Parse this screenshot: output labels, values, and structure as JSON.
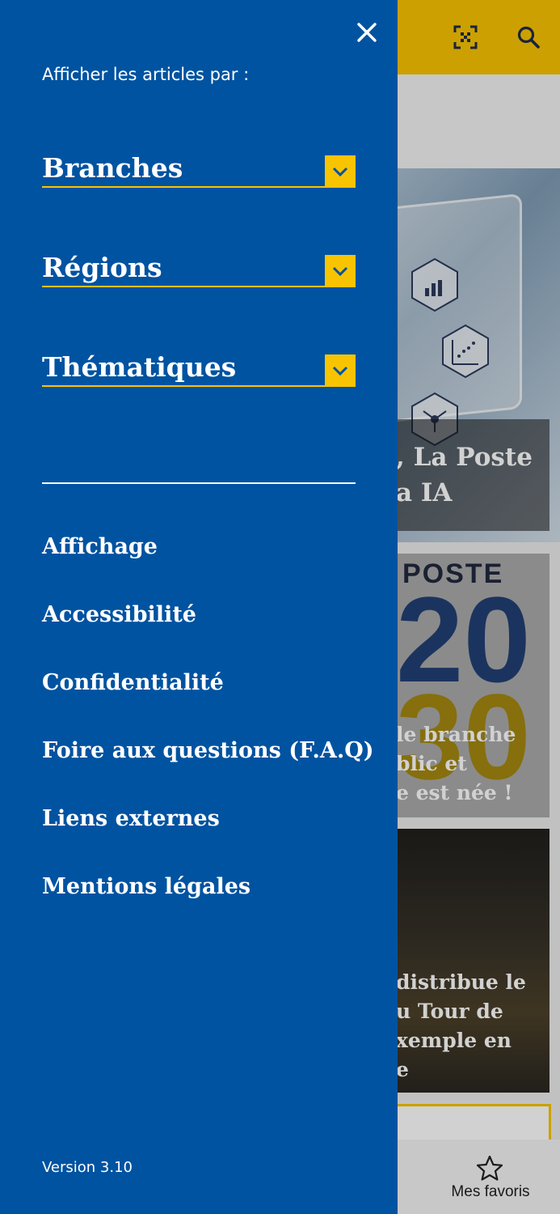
{
  "background": {
    "hero_title_lines": [
      ", La Poste",
      "a IA"
    ],
    "card2_brand": "POSTE",
    "card2_big_top": "20",
    "card2_big_bottom": "30",
    "card2_title_lines": [
      "le branche",
      "blic et",
      "e est née !"
    ],
    "card3_title_lines": [
      " distribue le",
      "u Tour de",
      "xemple en",
      "e"
    ],
    "bottom_nav": {
      "favorites_label": "Mes favoris"
    }
  },
  "drawer": {
    "heading": "Afficher les articles par :",
    "filters": [
      {
        "label": "Branches"
      },
      {
        "label": "Régions"
      },
      {
        "label": "Thématiques"
      }
    ],
    "menu": [
      {
        "label": "Affichage"
      },
      {
        "label": "Accessibilité"
      },
      {
        "label": "Confidentialité"
      },
      {
        "label": "Foire aux questions (F.A.Q)"
      },
      {
        "label": "Liens externes"
      },
      {
        "label": "Mentions légales"
      }
    ],
    "version": "Version 3.10"
  },
  "colors": {
    "drawer_blue": "#0053a1",
    "accent_yellow": "#f8c400"
  },
  "icons": {
    "close": "close-icon",
    "qr": "qr-scan-icon",
    "search": "search-icon",
    "chevron": "chevron-down-icon",
    "favorite": "star-icon"
  }
}
